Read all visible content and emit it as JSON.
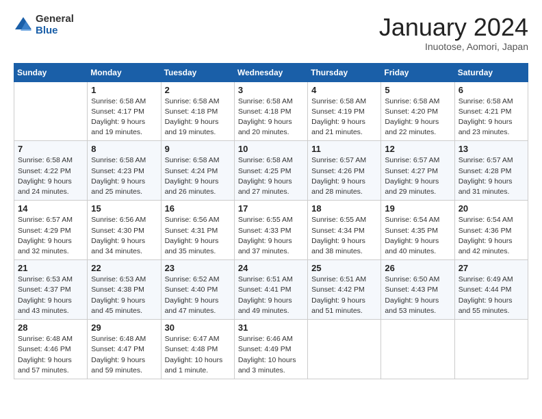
{
  "header": {
    "logo": {
      "general": "General",
      "blue": "Blue"
    },
    "title": "January 2024",
    "subtitle": "Inuotose, Aomori, Japan"
  },
  "weekdays": [
    "Sunday",
    "Monday",
    "Tuesday",
    "Wednesday",
    "Thursday",
    "Friday",
    "Saturday"
  ],
  "weeks": [
    [
      {
        "day": null,
        "info": null
      },
      {
        "day": "1",
        "info": "Sunrise: 6:58 AM\nSunset: 4:17 PM\nDaylight: 9 hours\nand 19 minutes."
      },
      {
        "day": "2",
        "info": "Sunrise: 6:58 AM\nSunset: 4:18 PM\nDaylight: 9 hours\nand 19 minutes."
      },
      {
        "day": "3",
        "info": "Sunrise: 6:58 AM\nSunset: 4:18 PM\nDaylight: 9 hours\nand 20 minutes."
      },
      {
        "day": "4",
        "info": "Sunrise: 6:58 AM\nSunset: 4:19 PM\nDaylight: 9 hours\nand 21 minutes."
      },
      {
        "day": "5",
        "info": "Sunrise: 6:58 AM\nSunset: 4:20 PM\nDaylight: 9 hours\nand 22 minutes."
      },
      {
        "day": "6",
        "info": "Sunrise: 6:58 AM\nSunset: 4:21 PM\nDaylight: 9 hours\nand 23 minutes."
      }
    ],
    [
      {
        "day": "7",
        "info": "Sunrise: 6:58 AM\nSunset: 4:22 PM\nDaylight: 9 hours\nand 24 minutes."
      },
      {
        "day": "8",
        "info": "Sunrise: 6:58 AM\nSunset: 4:23 PM\nDaylight: 9 hours\nand 25 minutes."
      },
      {
        "day": "9",
        "info": "Sunrise: 6:58 AM\nSunset: 4:24 PM\nDaylight: 9 hours\nand 26 minutes."
      },
      {
        "day": "10",
        "info": "Sunrise: 6:58 AM\nSunset: 4:25 PM\nDaylight: 9 hours\nand 27 minutes."
      },
      {
        "day": "11",
        "info": "Sunrise: 6:57 AM\nSunset: 4:26 PM\nDaylight: 9 hours\nand 28 minutes."
      },
      {
        "day": "12",
        "info": "Sunrise: 6:57 AM\nSunset: 4:27 PM\nDaylight: 9 hours\nand 29 minutes."
      },
      {
        "day": "13",
        "info": "Sunrise: 6:57 AM\nSunset: 4:28 PM\nDaylight: 9 hours\nand 31 minutes."
      }
    ],
    [
      {
        "day": "14",
        "info": "Sunrise: 6:57 AM\nSunset: 4:29 PM\nDaylight: 9 hours\nand 32 minutes."
      },
      {
        "day": "15",
        "info": "Sunrise: 6:56 AM\nSunset: 4:30 PM\nDaylight: 9 hours\nand 34 minutes."
      },
      {
        "day": "16",
        "info": "Sunrise: 6:56 AM\nSunset: 4:31 PM\nDaylight: 9 hours\nand 35 minutes."
      },
      {
        "day": "17",
        "info": "Sunrise: 6:55 AM\nSunset: 4:33 PM\nDaylight: 9 hours\nand 37 minutes."
      },
      {
        "day": "18",
        "info": "Sunrise: 6:55 AM\nSunset: 4:34 PM\nDaylight: 9 hours\nand 38 minutes."
      },
      {
        "day": "19",
        "info": "Sunrise: 6:54 AM\nSunset: 4:35 PM\nDaylight: 9 hours\nand 40 minutes."
      },
      {
        "day": "20",
        "info": "Sunrise: 6:54 AM\nSunset: 4:36 PM\nDaylight: 9 hours\nand 42 minutes."
      }
    ],
    [
      {
        "day": "21",
        "info": "Sunrise: 6:53 AM\nSunset: 4:37 PM\nDaylight: 9 hours\nand 43 minutes."
      },
      {
        "day": "22",
        "info": "Sunrise: 6:53 AM\nSunset: 4:38 PM\nDaylight: 9 hours\nand 45 minutes."
      },
      {
        "day": "23",
        "info": "Sunrise: 6:52 AM\nSunset: 4:40 PM\nDaylight: 9 hours\nand 47 minutes."
      },
      {
        "day": "24",
        "info": "Sunrise: 6:51 AM\nSunset: 4:41 PM\nDaylight: 9 hours\nand 49 minutes."
      },
      {
        "day": "25",
        "info": "Sunrise: 6:51 AM\nSunset: 4:42 PM\nDaylight: 9 hours\nand 51 minutes."
      },
      {
        "day": "26",
        "info": "Sunrise: 6:50 AM\nSunset: 4:43 PM\nDaylight: 9 hours\nand 53 minutes."
      },
      {
        "day": "27",
        "info": "Sunrise: 6:49 AM\nSunset: 4:44 PM\nDaylight: 9 hours\nand 55 minutes."
      }
    ],
    [
      {
        "day": "28",
        "info": "Sunrise: 6:48 AM\nSunset: 4:46 PM\nDaylight: 9 hours\nand 57 minutes."
      },
      {
        "day": "29",
        "info": "Sunrise: 6:48 AM\nSunset: 4:47 PM\nDaylight: 9 hours\nand 59 minutes."
      },
      {
        "day": "30",
        "info": "Sunrise: 6:47 AM\nSunset: 4:48 PM\nDaylight: 10 hours\nand 1 minute."
      },
      {
        "day": "31",
        "info": "Sunrise: 6:46 AM\nSunset: 4:49 PM\nDaylight: 10 hours\nand 3 minutes."
      },
      {
        "day": null,
        "info": null
      },
      {
        "day": null,
        "info": null
      },
      {
        "day": null,
        "info": null
      }
    ]
  ]
}
